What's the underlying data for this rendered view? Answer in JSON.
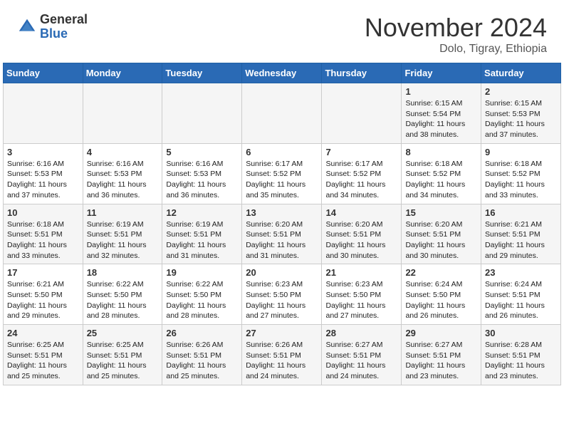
{
  "header": {
    "logo_general": "General",
    "logo_blue": "Blue",
    "month_title": "November 2024",
    "location": "Dolo, Tigray, Ethiopia"
  },
  "days_of_week": [
    "Sunday",
    "Monday",
    "Tuesday",
    "Wednesday",
    "Thursday",
    "Friday",
    "Saturday"
  ],
  "weeks": [
    {
      "days": [
        {
          "num": "",
          "info": ""
        },
        {
          "num": "",
          "info": ""
        },
        {
          "num": "",
          "info": ""
        },
        {
          "num": "",
          "info": ""
        },
        {
          "num": "",
          "info": ""
        },
        {
          "num": "1",
          "info": "Sunrise: 6:15 AM\nSunset: 5:54 PM\nDaylight: 11 hours\nand 38 minutes."
        },
        {
          "num": "2",
          "info": "Sunrise: 6:15 AM\nSunset: 5:53 PM\nDaylight: 11 hours\nand 37 minutes."
        }
      ]
    },
    {
      "days": [
        {
          "num": "3",
          "info": "Sunrise: 6:16 AM\nSunset: 5:53 PM\nDaylight: 11 hours\nand 37 minutes."
        },
        {
          "num": "4",
          "info": "Sunrise: 6:16 AM\nSunset: 5:53 PM\nDaylight: 11 hours\nand 36 minutes."
        },
        {
          "num": "5",
          "info": "Sunrise: 6:16 AM\nSunset: 5:53 PM\nDaylight: 11 hours\nand 36 minutes."
        },
        {
          "num": "6",
          "info": "Sunrise: 6:17 AM\nSunset: 5:52 PM\nDaylight: 11 hours\nand 35 minutes."
        },
        {
          "num": "7",
          "info": "Sunrise: 6:17 AM\nSunset: 5:52 PM\nDaylight: 11 hours\nand 34 minutes."
        },
        {
          "num": "8",
          "info": "Sunrise: 6:18 AM\nSunset: 5:52 PM\nDaylight: 11 hours\nand 34 minutes."
        },
        {
          "num": "9",
          "info": "Sunrise: 6:18 AM\nSunset: 5:52 PM\nDaylight: 11 hours\nand 33 minutes."
        }
      ]
    },
    {
      "days": [
        {
          "num": "10",
          "info": "Sunrise: 6:18 AM\nSunset: 5:51 PM\nDaylight: 11 hours\nand 33 minutes."
        },
        {
          "num": "11",
          "info": "Sunrise: 6:19 AM\nSunset: 5:51 PM\nDaylight: 11 hours\nand 32 minutes."
        },
        {
          "num": "12",
          "info": "Sunrise: 6:19 AM\nSunset: 5:51 PM\nDaylight: 11 hours\nand 31 minutes."
        },
        {
          "num": "13",
          "info": "Sunrise: 6:20 AM\nSunset: 5:51 PM\nDaylight: 11 hours\nand 31 minutes."
        },
        {
          "num": "14",
          "info": "Sunrise: 6:20 AM\nSunset: 5:51 PM\nDaylight: 11 hours\nand 30 minutes."
        },
        {
          "num": "15",
          "info": "Sunrise: 6:20 AM\nSunset: 5:51 PM\nDaylight: 11 hours\nand 30 minutes."
        },
        {
          "num": "16",
          "info": "Sunrise: 6:21 AM\nSunset: 5:51 PM\nDaylight: 11 hours\nand 29 minutes."
        }
      ]
    },
    {
      "days": [
        {
          "num": "17",
          "info": "Sunrise: 6:21 AM\nSunset: 5:50 PM\nDaylight: 11 hours\nand 29 minutes."
        },
        {
          "num": "18",
          "info": "Sunrise: 6:22 AM\nSunset: 5:50 PM\nDaylight: 11 hours\nand 28 minutes."
        },
        {
          "num": "19",
          "info": "Sunrise: 6:22 AM\nSunset: 5:50 PM\nDaylight: 11 hours\nand 28 minutes."
        },
        {
          "num": "20",
          "info": "Sunrise: 6:23 AM\nSunset: 5:50 PM\nDaylight: 11 hours\nand 27 minutes."
        },
        {
          "num": "21",
          "info": "Sunrise: 6:23 AM\nSunset: 5:50 PM\nDaylight: 11 hours\nand 27 minutes."
        },
        {
          "num": "22",
          "info": "Sunrise: 6:24 AM\nSunset: 5:50 PM\nDaylight: 11 hours\nand 26 minutes."
        },
        {
          "num": "23",
          "info": "Sunrise: 6:24 AM\nSunset: 5:51 PM\nDaylight: 11 hours\nand 26 minutes."
        }
      ]
    },
    {
      "days": [
        {
          "num": "24",
          "info": "Sunrise: 6:25 AM\nSunset: 5:51 PM\nDaylight: 11 hours\nand 25 minutes."
        },
        {
          "num": "25",
          "info": "Sunrise: 6:25 AM\nSunset: 5:51 PM\nDaylight: 11 hours\nand 25 minutes."
        },
        {
          "num": "26",
          "info": "Sunrise: 6:26 AM\nSunset: 5:51 PM\nDaylight: 11 hours\nand 25 minutes."
        },
        {
          "num": "27",
          "info": "Sunrise: 6:26 AM\nSunset: 5:51 PM\nDaylight: 11 hours\nand 24 minutes."
        },
        {
          "num": "28",
          "info": "Sunrise: 6:27 AM\nSunset: 5:51 PM\nDaylight: 11 hours\nand 24 minutes."
        },
        {
          "num": "29",
          "info": "Sunrise: 6:27 AM\nSunset: 5:51 PM\nDaylight: 11 hours\nand 23 minutes."
        },
        {
          "num": "30",
          "info": "Sunrise: 6:28 AM\nSunset: 5:51 PM\nDaylight: 11 hours\nand 23 minutes."
        }
      ]
    }
  ]
}
